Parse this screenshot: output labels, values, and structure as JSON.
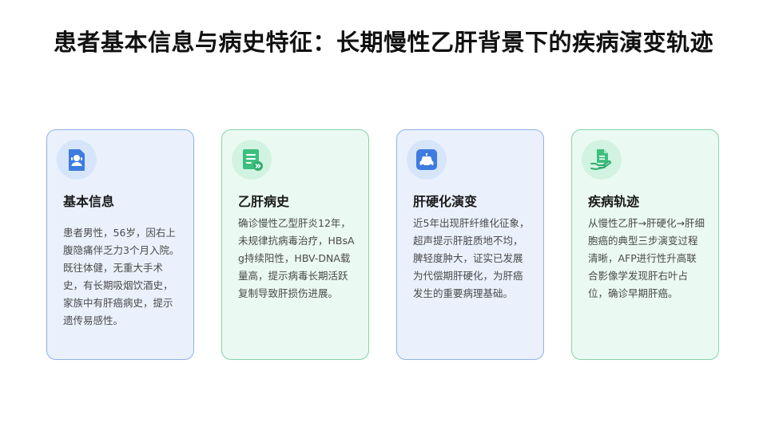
{
  "page": {
    "title": "患者基本信息与病史特征：长期慢性乙肝背景下的疾病演变轨迹"
  },
  "cards": [
    {
      "icon": "patient-id-icon",
      "title": "基本信息",
      "body": "患者男性，56岁，因右上腹隐痛伴乏力3个月入院。既往体健，无重大手术史，有长期吸烟饮酒史，家族中有肝癌病史，提示遗传易感性。"
    },
    {
      "icon": "medical-record-icon",
      "title": "乙肝病史",
      "body": "确诊慢性乙型肝炎12年，未规律抗病毒治疗，HBsAg持续阳性，HBV-DNA载量高，提示病毒长期活跃复制导致肝损伤进展。"
    },
    {
      "icon": "ambulance-icon",
      "title": "肝硬化演变",
      "body": "近5年出现肝纤维化征象，超声提示肝脏质地不均，脾轻度肿大，证实已发展为代偿期肝硬化，为肝癌发生的重要病理基础。"
    },
    {
      "icon": "hand-document-icon",
      "title": "疾病轨迹",
      "body": "从慢性乙肝→肝硬化→肝细胞癌的典型三步演变过程清晰，AFP进行性升高联合影像学发现肝右叶占位，确诊早期肝癌。"
    }
  ],
  "colors": {
    "blue_accent": "#3d7be0",
    "green_accent": "#3cc07f",
    "blue_card_bg": "#eaf1fd",
    "green_card_bg": "#eafaf2"
  }
}
